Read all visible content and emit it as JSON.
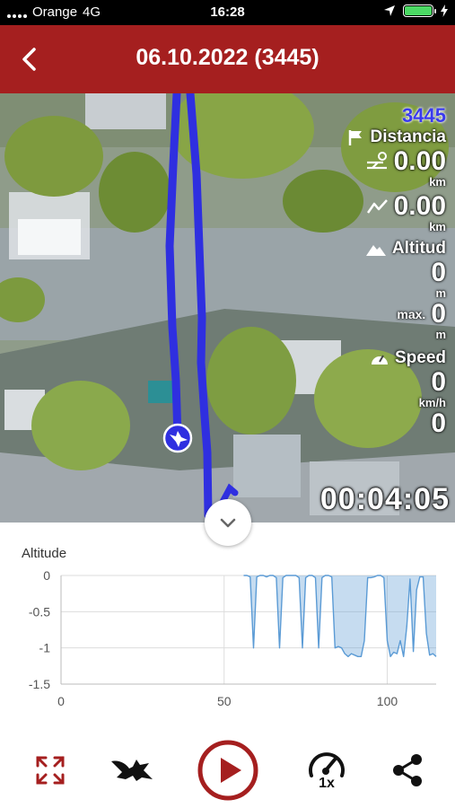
{
  "status_bar": {
    "carrier": "Orange",
    "network": "4G",
    "time": "16:28",
    "icons": [
      "signal-icon",
      "location-arrow-icon",
      "battery-icon",
      "charging-icon"
    ]
  },
  "header": {
    "title": "06.10.2022 (3445)",
    "back_icon": "chevron-left-icon",
    "background_color": "#a51f1f"
  },
  "map_overlay": {
    "track_id": "3445",
    "distance_label": "Distancia",
    "distance_value": "0.00",
    "distance_unit": "km",
    "distance2_value": "0.00",
    "distance2_unit": "km",
    "altitude_label": "Altitud",
    "altitude_value": "0",
    "altitude_unit": "m",
    "altitude_max_label": "max.",
    "altitude_max_value": "0",
    "altitude_max_unit": "m",
    "speed_label": "Speed",
    "speed_value": "0",
    "speed_unit": "km/h",
    "speed2_value": "0",
    "elapsed_time": "00:04:05",
    "track_color": "#2f2fe0"
  },
  "chart_data": {
    "type": "area",
    "title": "Altitude",
    "xlabel": "",
    "ylabel": "",
    "xlim": [
      0,
      115
    ],
    "ylim": [
      -1.5,
      0
    ],
    "x_ticks": [
      "0",
      "50",
      "100"
    ],
    "y_ticks": [
      "0",
      "-0.5",
      "-1",
      "-1.5"
    ],
    "grid": true,
    "series": [
      {
        "color": "#5b9bd5",
        "x": [
          56,
          57,
          58,
          59,
          60,
          61,
          62,
          63,
          64,
          65,
          66,
          67,
          68,
          69,
          70,
          71,
          72,
          73,
          74,
          75,
          76,
          77,
          78,
          79,
          80,
          81,
          82,
          83,
          84,
          85,
          86,
          87,
          88,
          89,
          90,
          91,
          92,
          93,
          94,
          95,
          96,
          97,
          98,
          99,
          100,
          101,
          102,
          103,
          104,
          105,
          106,
          107,
          108,
          109,
          110,
          111,
          112,
          113,
          114,
          115
        ],
        "y": [
          0,
          0,
          -0.02,
          -1.0,
          -0.02,
          0,
          0,
          -0.02,
          0,
          0,
          -0.03,
          -1.0,
          -0.03,
          0,
          0,
          0,
          0,
          -0.03,
          -1.0,
          -0.03,
          0,
          0,
          -0.03,
          -1.0,
          -0.03,
          0,
          0,
          -0.02,
          -1.0,
          -0.98,
          -1.0,
          -1.08,
          -1.12,
          -1.08,
          -1.1,
          -1.12,
          -1.12,
          -0.9,
          -0.03,
          -0.03,
          -0.02,
          0,
          0,
          -0.03,
          -0.9,
          -1.12,
          -1.06,
          -1.08,
          -0.9,
          -1.12,
          -0.7,
          -0.05,
          -1.05,
          -0.2,
          -0.02,
          -0.02,
          -0.8,
          -1.1,
          -1.08,
          -1.12
        ]
      }
    ]
  },
  "toolbar": {
    "fullscreen_icon": "expand-arrows-icon",
    "bird_icon": "eagle-icon",
    "play_icon": "play-button-icon",
    "speed_icon": "speedometer-icon",
    "speed_label": "1x",
    "share_icon": "share-icon",
    "accent_color": "#a51f1f"
  }
}
